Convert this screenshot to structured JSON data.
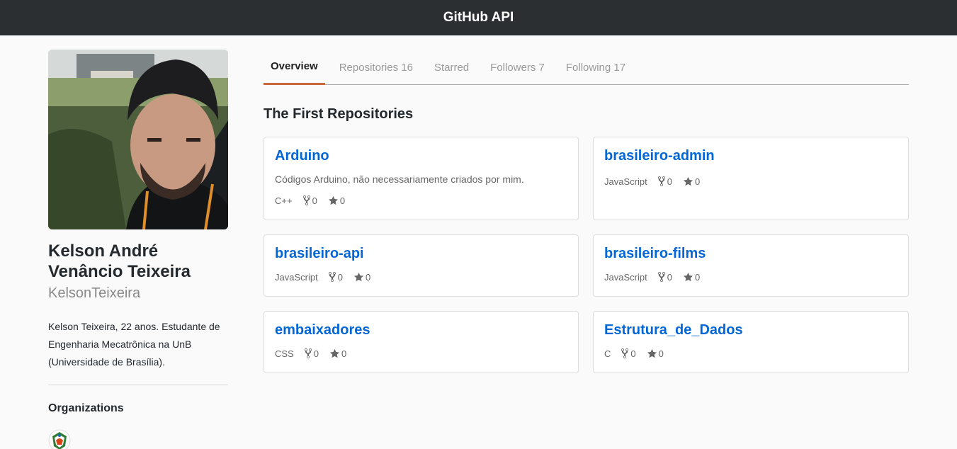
{
  "header": {
    "title": "GitHub API"
  },
  "profile": {
    "full_name": "Kelson André Venâncio Teixeira",
    "login": "KelsonTeixeira",
    "bio": "Kelson Teixeira, 22 anos. Estudante de Engenharia Mecatrônica na UnB (Universidade de Brasília).",
    "organizations_heading": "Organizations"
  },
  "tabs": [
    {
      "label": "Overview",
      "active": true
    },
    {
      "label": "Repositories 16"
    },
    {
      "label": "Starred"
    },
    {
      "label": "Followers 7"
    },
    {
      "label": "Following 17"
    }
  ],
  "section_title": "The First Repositories",
  "repos": [
    {
      "name": "Arduino",
      "description": "Códigos Arduino, não necessariamente criados por mim.",
      "language": "C++",
      "forks": "0",
      "stars": "0"
    },
    {
      "name": "brasileiro-admin",
      "description": "",
      "language": "JavaScript",
      "forks": "0",
      "stars": "0"
    },
    {
      "name": "brasileiro-api",
      "description": "",
      "language": "JavaScript",
      "forks": "0",
      "stars": "0"
    },
    {
      "name": "brasileiro-films",
      "description": "",
      "language": "JavaScript",
      "forks": "0",
      "stars": "0"
    },
    {
      "name": "embaixadores",
      "description": "",
      "language": "CSS",
      "forks": "0",
      "stars": "0"
    },
    {
      "name": "Estrutura_de_Dados",
      "description": "",
      "language": "C",
      "forks": "0",
      "stars": "0"
    }
  ],
  "icons": {
    "fork": "fork-icon",
    "star": "star-icon"
  },
  "colors": {
    "accent": "#c8693d",
    "link": "#0366d6",
    "topbar": "#2b2f31"
  }
}
